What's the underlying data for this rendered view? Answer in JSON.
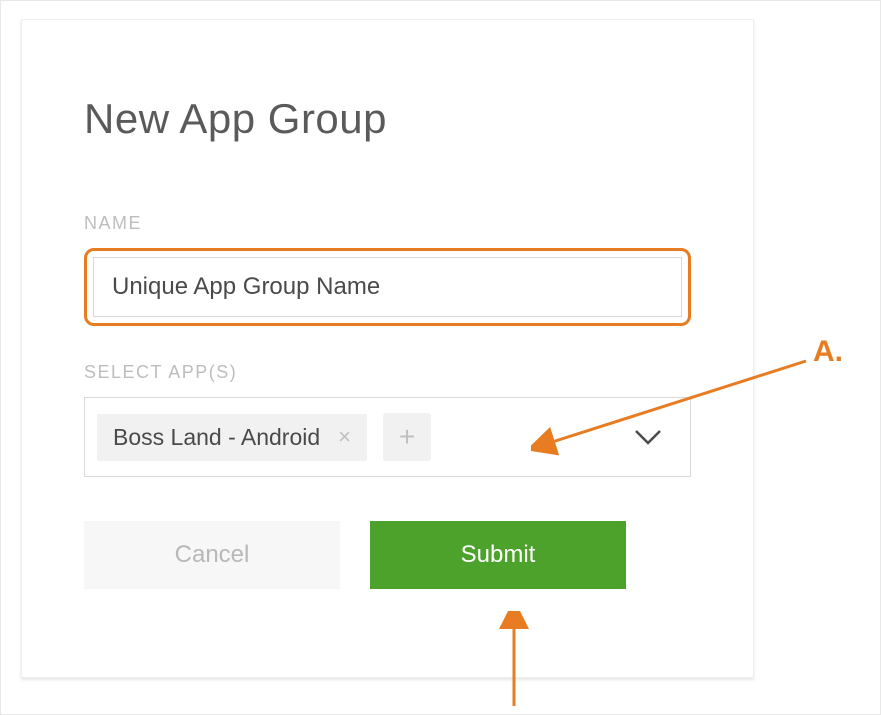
{
  "dialog": {
    "title": "New App Group",
    "name_label": "NAME",
    "name_value": "Unique App Group Name",
    "select_label": "SELECT APP(S)",
    "selected_app": "Boss Land - Android",
    "cancel_label": "Cancel",
    "submit_label": "Submit"
  },
  "annotation": {
    "label": "A."
  },
  "colors": {
    "accent_orange": "#e77c22",
    "submit_green": "#4da22b"
  }
}
